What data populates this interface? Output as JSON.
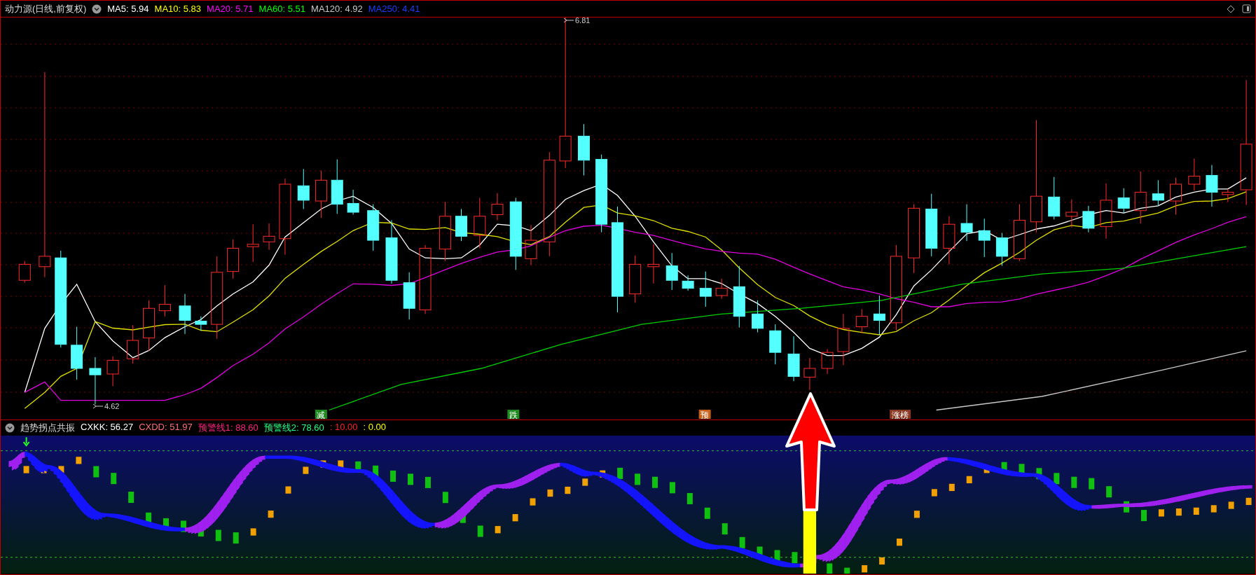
{
  "chart": {
    "title": "动力源(日线,前复权)",
    "ma_readings": [
      {
        "label": "MA5: 5.94",
        "color": "#ffffff"
      },
      {
        "label": "MA10: 5.83",
        "color": "#ffff00"
      },
      {
        "label": "MA20: 5.71",
        "color": "#ff00ff"
      },
      {
        "label": "MA60: 5.51",
        "color": "#00ff00"
      },
      {
        "label": "MA120: 4.92",
        "color": "#c8c8c8"
      },
      {
        "label": "MA250: 4.41",
        "color": "#1a3cff"
      }
    ],
    "high_label": "6.81",
    "low_label": "4.62",
    "signals": [
      {
        "label": "减",
        "color": "#1f8a1f"
      },
      {
        "label": "跌",
        "color": "#1f8a1f"
      },
      {
        "label": "预",
        "color": "#c8601a"
      },
      {
        "label": "涨榜",
        "color": "#8a3a22"
      }
    ]
  },
  "indicator": {
    "title": "趋势拐点共振",
    "readings": [
      {
        "label": "CXKK: 56.27",
        "color": "#ffffff"
      },
      {
        "label": "CXDD: 51.97",
        "color": "#ff7070"
      },
      {
        "label": "预警线1: 88.60",
        "color": "#ff2080"
      },
      {
        "label": "预警线2: 78.60",
        "color": "#20ff80"
      },
      {
        "label": ": 10.00",
        "color": "#ff2020"
      },
      {
        "label": ": 0.00",
        "color": "#ffff00"
      }
    ]
  }
}
